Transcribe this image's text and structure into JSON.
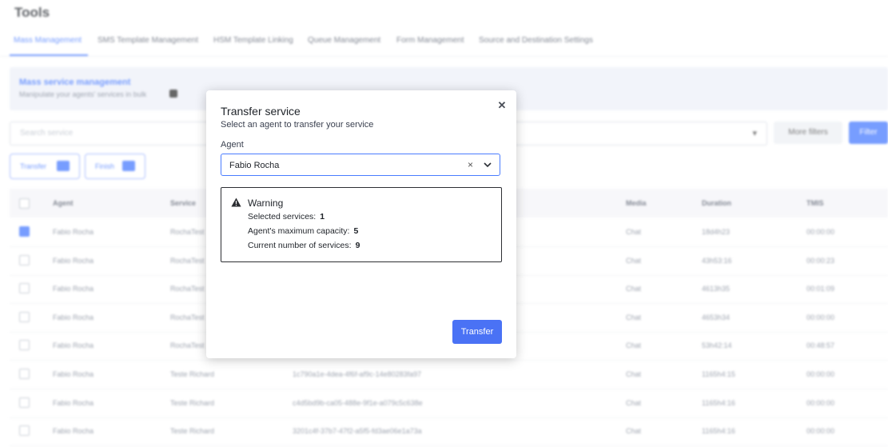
{
  "page": {
    "title": "Tools",
    "tabs": [
      {
        "label": "Mass Management",
        "active": true
      },
      {
        "label": "SMS Template Management",
        "active": false
      },
      {
        "label": "HSM Template Linking",
        "active": false
      },
      {
        "label": "Queue Management",
        "active": false
      },
      {
        "label": "Form Management",
        "active": false
      },
      {
        "label": "Source and Destination Settings",
        "active": false
      }
    ],
    "banner": {
      "title": "Mass service management",
      "subtitle": "Manipulate your agents' services in bulk"
    },
    "search": {
      "placeholder": "Search service"
    },
    "more_filters_label": "More filters",
    "filter_label": "Filter",
    "actions": [
      {
        "label": "Transfer"
      },
      {
        "label": "Finish"
      }
    ],
    "table": {
      "columns": [
        "Agent",
        "Service",
        "",
        "Media",
        "Duration",
        "TMIS"
      ],
      "rows": [
        {
          "checked": true,
          "agent": "Fabio Rocha",
          "service": "RochaTest",
          "id": "",
          "media": "Chat",
          "duration": "18d4h23",
          "tmis": "00:00:00"
        },
        {
          "checked": false,
          "agent": "Fabio Rocha",
          "service": "RochaTest",
          "id": "",
          "media": "Chat",
          "duration": "43h53:16",
          "tmis": "00:00:23"
        },
        {
          "checked": false,
          "agent": "Fabio Rocha",
          "service": "RochaTest",
          "id": "",
          "media": "Chat",
          "duration": "4613h35",
          "tmis": "00:01:09"
        },
        {
          "checked": false,
          "agent": "Fabio Rocha",
          "service": "RochaTest",
          "id": "",
          "media": "Chat",
          "duration": "4653h34",
          "tmis": "00:00:00"
        },
        {
          "checked": false,
          "agent": "Fabio Rocha",
          "service": "RochaTest",
          "id": "",
          "media": "Chat",
          "duration": "53h42:14",
          "tmis": "00:48:57"
        },
        {
          "checked": false,
          "agent": "Fabio Rocha",
          "service": "Teste Richard",
          "id": "1c790a1e-4dea-4f6f-af9c-14e80283fa97",
          "media": "Chat",
          "duration": "1165h4:15",
          "tmis": "00:00:00"
        },
        {
          "checked": false,
          "agent": "Fabio Rocha",
          "service": "Teste Richard",
          "id": "c4d5bd9b-ca05-488e-9f1e-a079c5c638e",
          "media": "Chat",
          "duration": "1165h4:16",
          "tmis": "00:00:00"
        },
        {
          "checked": false,
          "agent": "Fabio Rocha",
          "service": "Teste Richard",
          "id": "3201c4f-37b7-47f2-a5f5-fd3ae06e1a73a",
          "media": "Chat",
          "duration": "1165h4:16",
          "tmis": "00:00:00"
        }
      ]
    }
  },
  "modal": {
    "title": "Transfer service",
    "subtitle": "Select an agent to transfer your service",
    "close_icon": "close-icon",
    "agent_label": "Agent",
    "agent_value": "Fabio Rocha",
    "clear_icon": "clear-icon",
    "dropdown_icon": "chevron-down-icon",
    "warning": {
      "icon": "warning-icon",
      "title": "Warning",
      "selected_label": "Selected services:",
      "selected_value": "1",
      "capacity_label": "Agent's maximum capacity:",
      "capacity_value": "5",
      "current_label": "Current number of services:",
      "current_value": "9"
    },
    "transfer_label": "Transfer"
  },
  "colors": {
    "accent": "#4a72f5",
    "overlay": "#ffffff"
  }
}
